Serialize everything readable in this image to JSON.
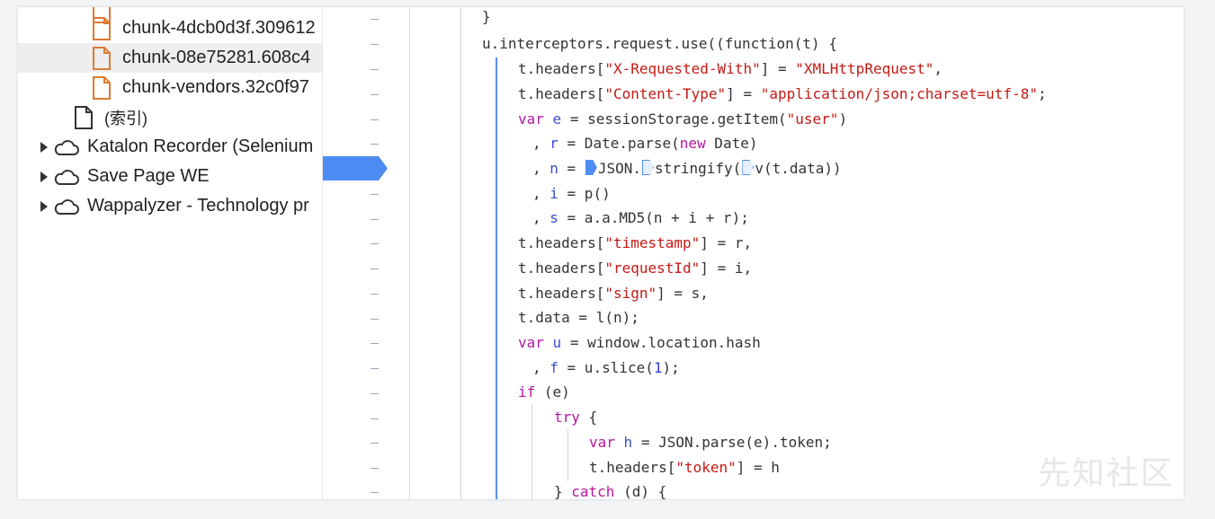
{
  "tree": {
    "items": [
      {
        "label": "chunk-4dcb0d3f.309612",
        "type": "file"
      },
      {
        "label": "chunk-08e75281.608c4",
        "type": "file",
        "selected": true
      },
      {
        "label": "chunk-vendors.32c0f97",
        "type": "file"
      },
      {
        "label": "(索引)",
        "type": "file-plain"
      },
      {
        "label": "Katalon Recorder (Selenium",
        "type": "extension"
      },
      {
        "label": "Save Page WE",
        "type": "extension"
      },
      {
        "label": "Wappalyzer - Technology pr",
        "type": "extension"
      }
    ]
  },
  "code": {
    "line01": "}",
    "line02": "u.interceptors.request.use((function(t) {",
    "line03a": "t.headers[",
    "line03b": "\"X-Requested-With\"",
    "line03c": "] = ",
    "line03d": "\"XMLHttpRequest\"",
    "line03e": ",",
    "line04a": "t.headers[",
    "line04b": "\"Content-Type\"",
    "line04c": "] = ",
    "line04d": "\"application/json;charset=utf-8\"",
    "line04e": ";",
    "line05a": "var",
    "line05b": "e",
    "line05c": " = sessionStorage.getItem(",
    "line05d": "\"user\"",
    "line05e": ")",
    "line06a": ", ",
    "line06b": "r",
    "line06c": " = Date.parse(",
    "line06d": "new",
    "line06e": " Date)",
    "line07a": ", ",
    "line07b": "n",
    "line07c": " = ",
    "line07d": "JSON.",
    "line07e": "stringify(",
    "line07f": "v(t.data))",
    "line08a": ", ",
    "line08b": "i",
    "line08c": " = p()",
    "line09a": ", ",
    "line09b": "s",
    "line09c": " = a.a.MD5(n + i + r);",
    "line10a": "t.headers[",
    "line10b": "\"timestamp\"",
    "line10c": "] = r,",
    "line11a": "t.headers[",
    "line11b": "\"requestId\"",
    "line11c": "] = i,",
    "line12a": "t.headers[",
    "line12b": "\"sign\"",
    "line12c": "] = s,",
    "line13": "t.data = l(n);",
    "line14a": "var",
    "line14b": "u",
    "line14c": " = window.location.hash",
    "line15a": ", ",
    "line15b": "f",
    "line15c": " = u.slice(",
    "line15d": "1",
    "line15e": ");",
    "line16a": "if",
    "line16b": " (e)",
    "line17a": "try",
    "line17b": " {",
    "line18a": "var",
    "line18b": "h",
    "line18c": " = JSON.parse(e).token;",
    "line19a": "t.headers[",
    "line19b": "\"token\"",
    "line19c": "] = h",
    "line20a": "} ",
    "line20b": "catch",
    "line20c": " (d) {"
  },
  "watermark": "先知社区",
  "colors": {
    "accent": "#4d8cf2",
    "keyword": "#b5179e",
    "string": "#c41a16",
    "variable": "#3b4ed1"
  }
}
